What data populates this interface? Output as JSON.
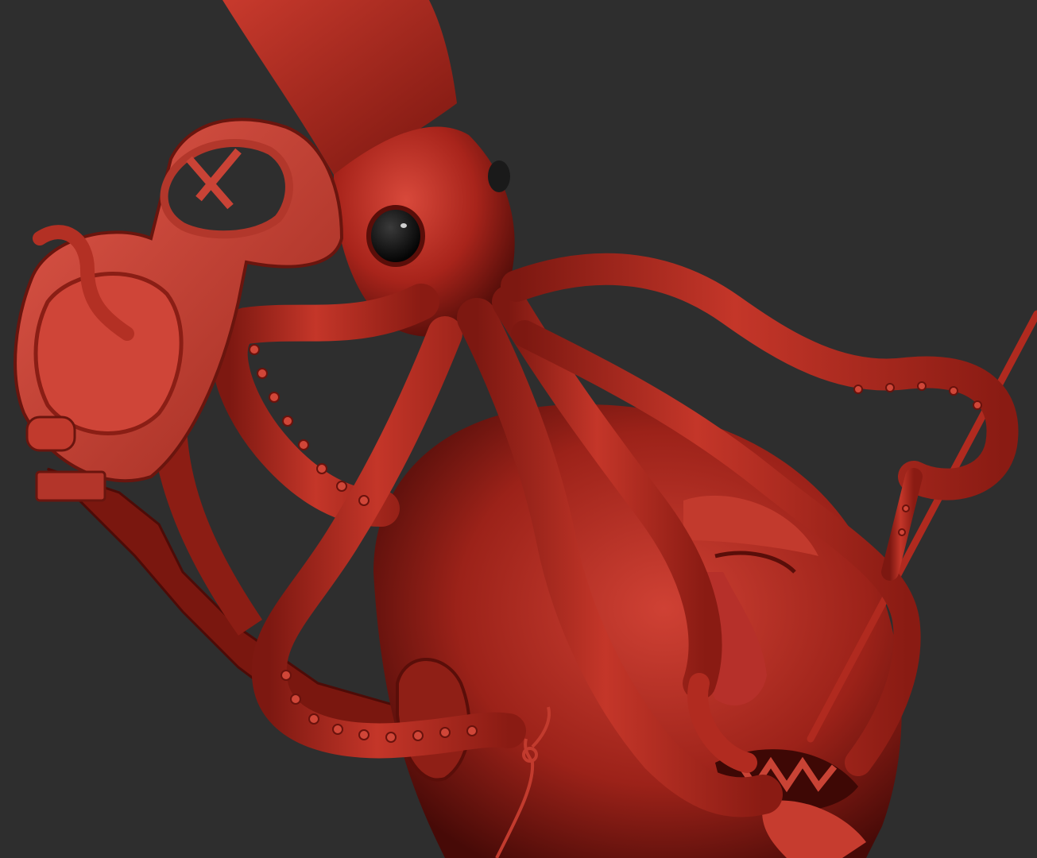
{
  "viewport": {
    "background_color": "#2e2e2e",
    "material_color": "#b0271d",
    "material_highlight": "#d2473a",
    "material_shadow": "#5c0e0a",
    "eye_color": "#0c0c0c"
  },
  "scene": {
    "objects": [
      {
        "name": "squid-mantle",
        "kind": "sculpt"
      },
      {
        "name": "squid-head",
        "kind": "sculpt"
      },
      {
        "name": "squid-eye",
        "kind": "sculpt"
      },
      {
        "name": "diving-mask",
        "kind": "sculpt"
      },
      {
        "name": "mask-strap",
        "kind": "sculpt"
      },
      {
        "name": "human-head",
        "kind": "sculpt"
      },
      {
        "name": "tentacles",
        "kind": "sculpt"
      },
      {
        "name": "speargun-rod",
        "kind": "sculpt"
      },
      {
        "name": "fishing-hook",
        "kind": "sculpt"
      }
    ]
  }
}
